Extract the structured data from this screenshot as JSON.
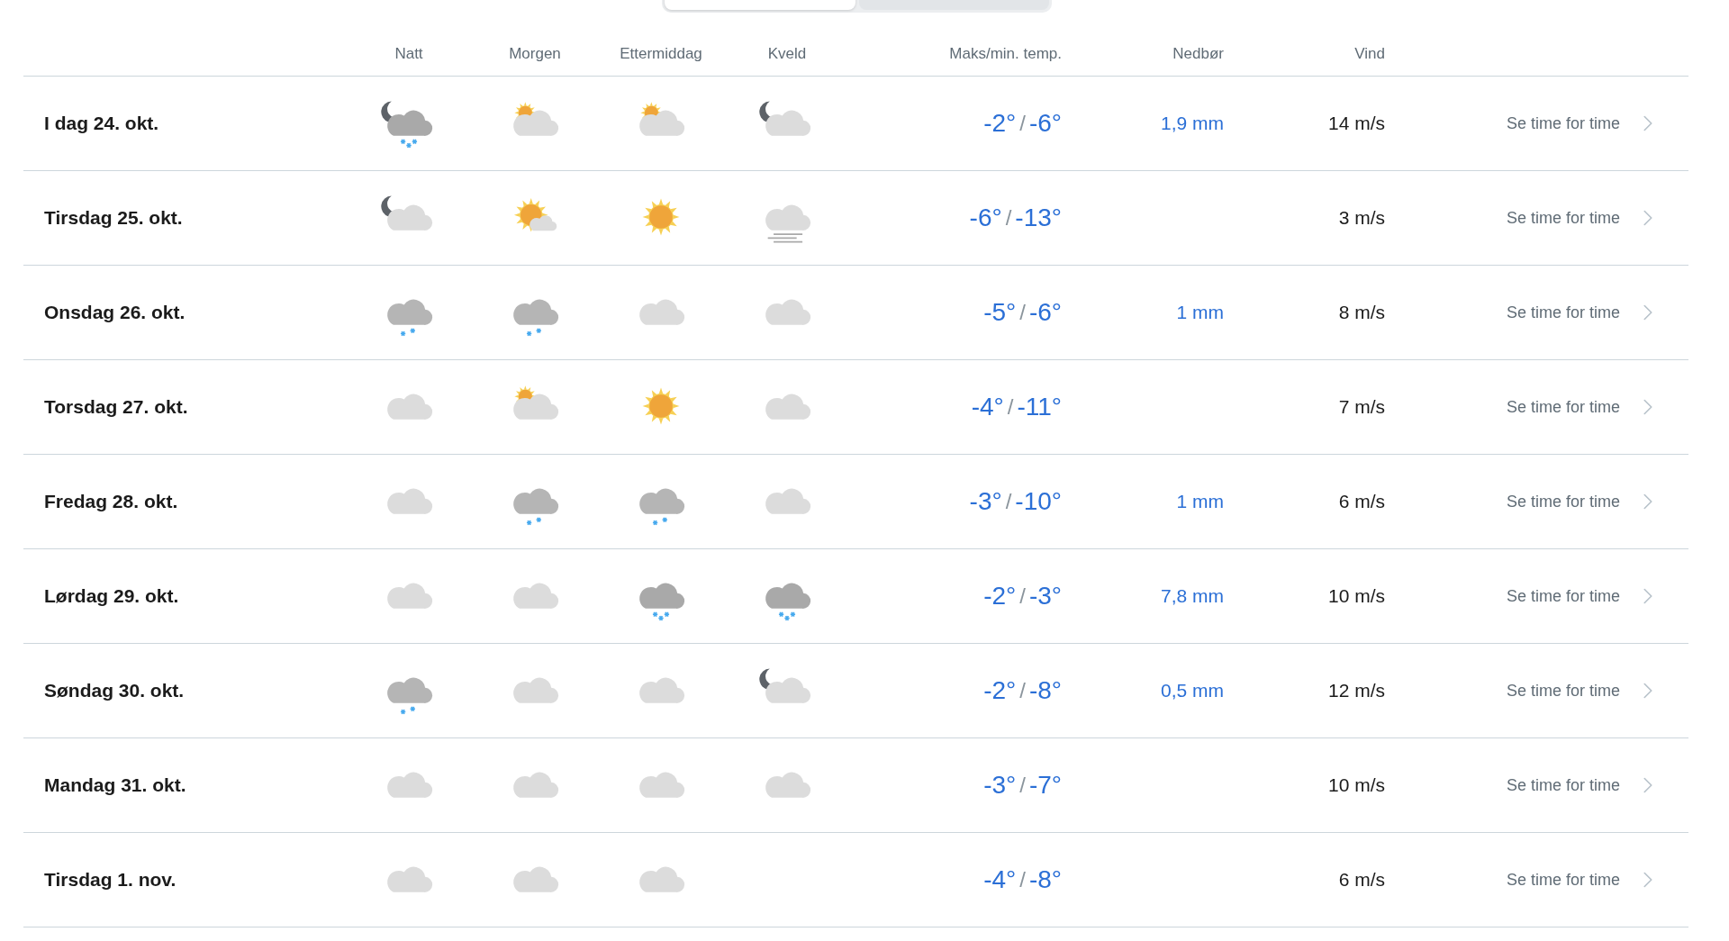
{
  "view_switch": {
    "segments": [
      {
        "selected": true
      },
      {
        "selected": false
      }
    ]
  },
  "temp_separator": "/",
  "columns": [
    "Natt",
    "Morgen",
    "Ettermiddag",
    "Kveld",
    "Maks/min. temp.",
    "Nedbør",
    "Vind"
  ],
  "days": [
    {
      "date": "I dag 24. okt.",
      "periods": [
        {
          "kind": "night-snow"
        },
        {
          "kind": "day-cloudy"
        },
        {
          "kind": "day-cloudy"
        },
        {
          "kind": "night-cloudy"
        }
      ],
      "max": "-2°",
      "min": "-6°",
      "precipitation": "1,9 mm",
      "wind": "14 m/s",
      "link": "Se time for time"
    },
    {
      "date": "Tirsdag 25. okt.",
      "periods": [
        {
          "kind": "night-cloudy"
        },
        {
          "kind": "fair"
        },
        {
          "kind": "sun"
        },
        {
          "kind": "fog"
        }
      ],
      "max": "-6°",
      "min": "-13°",
      "wind": "3 m/s",
      "link": "Se time for time"
    },
    {
      "date": "Onsdag 26. okt.",
      "periods": [
        {
          "kind": "light-snow"
        },
        {
          "kind": "light-snow"
        },
        {
          "kind": "cloud"
        },
        {
          "kind": "cloud"
        }
      ],
      "max": "-5°",
      "min": "-6°",
      "precipitation": "1 mm",
      "wind": "8 m/s",
      "link": "Se time for time"
    },
    {
      "date": "Torsdag 27. okt.",
      "periods": [
        {
          "kind": "cloud"
        },
        {
          "kind": "day-cloudy"
        },
        {
          "kind": "sun"
        },
        {
          "kind": "cloud"
        }
      ],
      "max": "-4°",
      "min": "-11°",
      "wind": "7 m/s",
      "link": "Se time for time"
    },
    {
      "date": "Fredag 28. okt.",
      "periods": [
        {
          "kind": "cloud"
        },
        {
          "kind": "light-snow"
        },
        {
          "kind": "light-snow"
        },
        {
          "kind": "cloud"
        }
      ],
      "max": "-3°",
      "min": "-10°",
      "precipitation": "1 mm",
      "wind": "6 m/s",
      "link": "Se time for time"
    },
    {
      "date": "Lørdag 29. okt.",
      "periods": [
        {
          "kind": "cloud"
        },
        {
          "kind": "cloud"
        },
        {
          "kind": "snow"
        },
        {
          "kind": "snow"
        }
      ],
      "max": "-2°",
      "min": "-3°",
      "precipitation": "7,8 mm",
      "wind": "10 m/s",
      "link": "Se time for time"
    },
    {
      "date": "Søndag 30. okt.",
      "periods": [
        {
          "kind": "light-snow"
        },
        {
          "kind": "cloud"
        },
        {
          "kind": "cloud"
        },
        {
          "kind": "night-cloudy"
        }
      ],
      "max": "-2°",
      "min": "-8°",
      "precipitation": "0,5 mm",
      "wind": "12 m/s",
      "link": "Se time for time"
    },
    {
      "date": "Mandag 31. okt.",
      "periods": [
        {
          "kind": "cloud"
        },
        {
          "kind": "cloud"
        },
        {
          "kind": "cloud"
        },
        {
          "kind": "cloud"
        }
      ],
      "max": "-3°",
      "min": "-7°",
      "wind": "10 m/s",
      "link": "Se time for time"
    },
    {
      "date": "Tirsdag 1. nov.",
      "periods": [
        {
          "kind": "cloud"
        },
        {
          "kind": "cloud"
        },
        {
          "kind": "cloud"
        }
      ],
      "max": "-4°",
      "min": "-8°",
      "wind": "6 m/s",
      "link": "Se time for time"
    }
  ]
}
